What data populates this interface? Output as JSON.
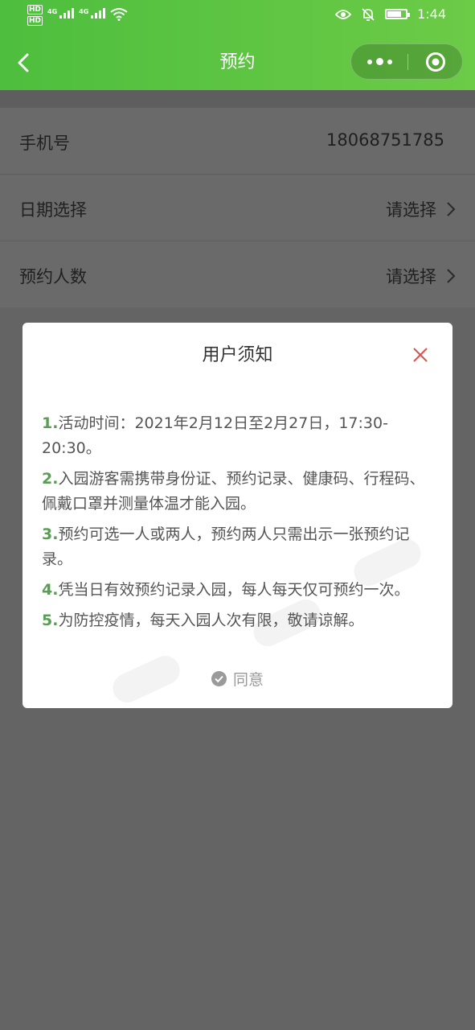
{
  "status_bar": {
    "time": "1:44",
    "network_1": "4G",
    "network_2": "4G",
    "hd_1": "HD",
    "hd_2": "HD"
  },
  "nav": {
    "title": "预约"
  },
  "form": {
    "phone": {
      "label": "手机号",
      "value": "18068751785"
    },
    "date": {
      "label": "日期选择",
      "placeholder": "请选择"
    },
    "people": {
      "label": "预约人数",
      "placeholder": "请选择"
    }
  },
  "modal": {
    "title": "用户须知",
    "items": [
      {
        "num": "1.",
        "text": "活动时间：2021年2月12日至2月27日，17:30-20:30。"
      },
      {
        "num": "2.",
        "text": "入园游客需携带身份证、预约记录、健康码、行程码、佩戴口罩并测量体温才能入园。"
      },
      {
        "num": "3.",
        "text": "预约可选一人或两人，预约两人只需出示一张预约记录。"
      },
      {
        "num": "4.",
        "text": "凭当日有效预约记录入园，每人每天仅可预约一次。"
      },
      {
        "num": "5.",
        "text": "为防控疫情，每天入园人次有限，敬请谅解。"
      }
    ],
    "agree_label": "同意"
  },
  "battery_level": 0.85,
  "colors": {
    "header_green": "#58c143",
    "number_green": "#5a9e55",
    "close_red": "#d9534f",
    "overlay_gray": "#646464"
  }
}
